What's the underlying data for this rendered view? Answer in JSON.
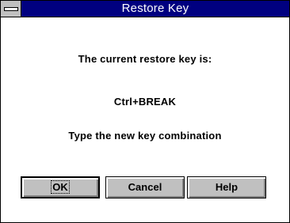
{
  "window": {
    "title": "Restore Key"
  },
  "content": {
    "line1": "The current restore key is:",
    "line2": "Ctrl+BREAK",
    "line3": "Type the new key combination"
  },
  "buttons": {
    "ok": "OK",
    "cancel": "Cancel",
    "help": "Help"
  },
  "colors": {
    "titlebar": "#000080",
    "button_face": "#c0c0c0",
    "background": "#ffffff"
  },
  "icons": {
    "system_menu": "system-menu-icon"
  }
}
